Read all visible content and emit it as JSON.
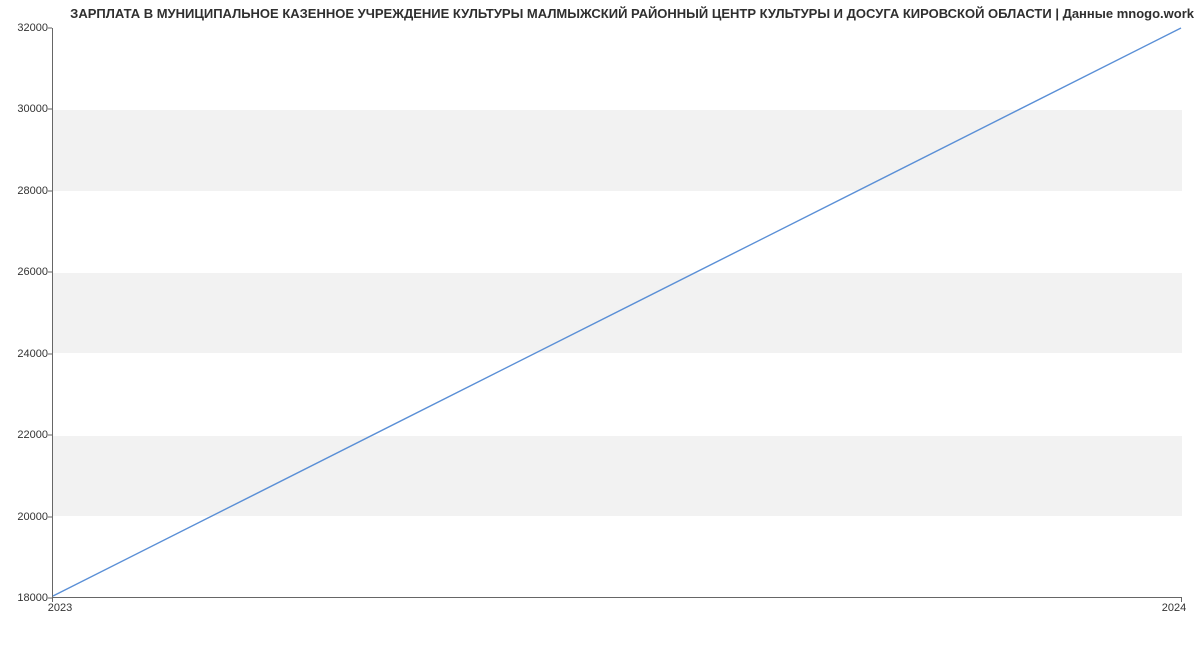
{
  "chart_data": {
    "type": "line",
    "title": "ЗАРПЛАТА В МУНИЦИПАЛЬНОЕ КАЗЕННОЕ УЧРЕЖДЕНИЕ КУЛЬТУРЫ МАЛМЫЖСКИЙ РАЙОННЫЙ ЦЕНТР КУЛЬТУРЫ И ДОСУГА КИРОВСКОЙ ОБЛАСТИ | Данные mnogo.work",
    "x": [
      2023,
      2024
    ],
    "values": [
      18000,
      32000
    ],
    "xlabel": "",
    "ylabel": "",
    "xlim": [
      2023,
      2024
    ],
    "ylim": [
      18000,
      32000
    ],
    "x_ticks": [
      2023,
      2024
    ],
    "y_ticks": [
      18000,
      20000,
      22000,
      24000,
      26000,
      28000,
      30000,
      32000
    ],
    "line_color": "#5a8fd6"
  }
}
